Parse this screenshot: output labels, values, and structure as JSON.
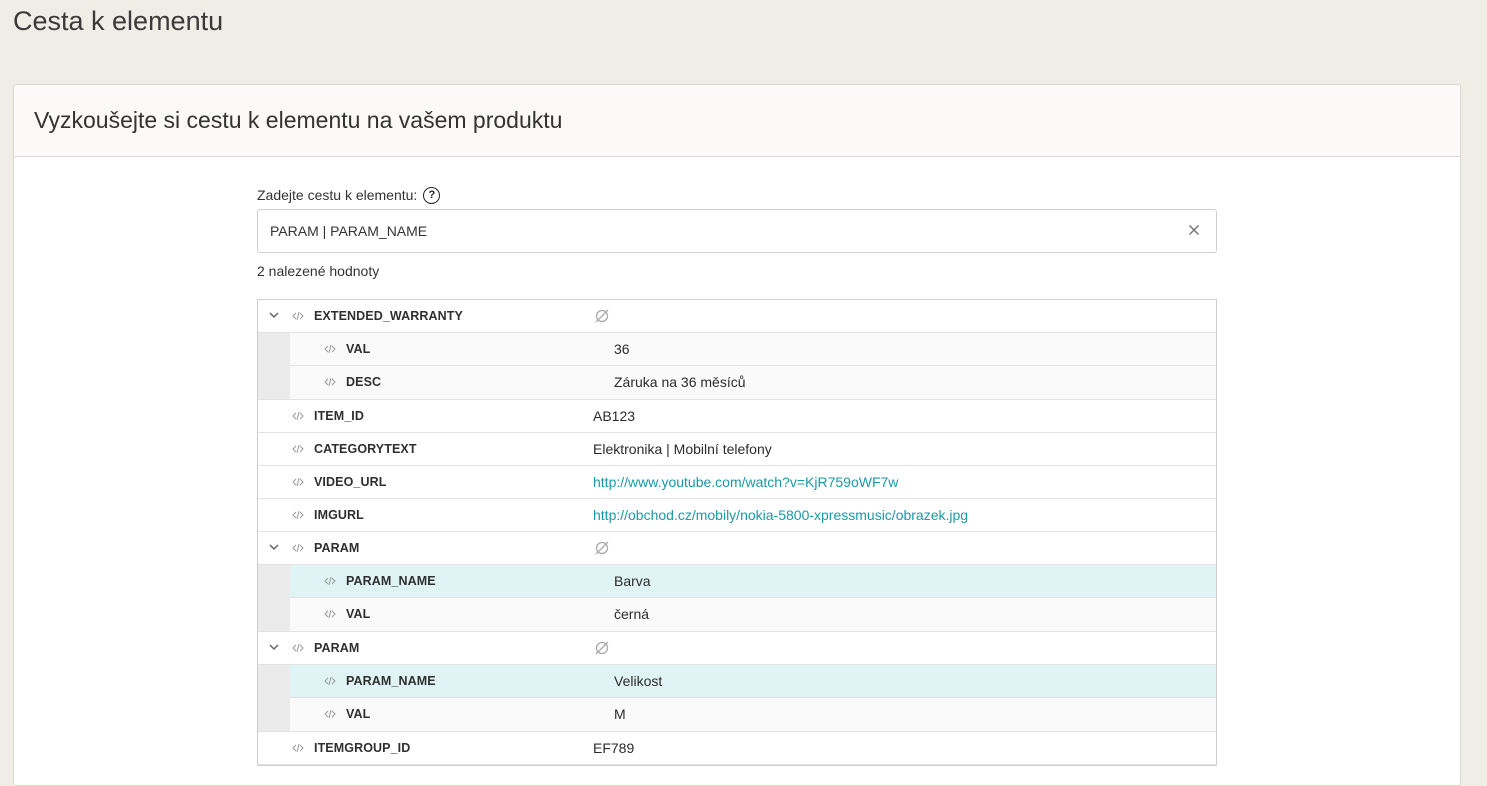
{
  "page": {
    "title": "Cesta k elementu"
  },
  "card": {
    "title": "Vyzkoušejte si cestu k elementu na vašem produktu"
  },
  "form": {
    "label": "Zadejte cestu k elementu:",
    "path_value": "PARAM | PARAM_NAME",
    "found_count": "2 nalezené hodnoty"
  },
  "tree": {
    "g1": {
      "key": "EXTENDED_WARRANTY",
      "c1": {
        "key": "VAL",
        "value": "36"
      },
      "c2": {
        "key": "DESC",
        "value": "Záruka na 36 měsíců"
      }
    },
    "r1": {
      "key": "ITEM_ID",
      "value": "AB123"
    },
    "r2": {
      "key": "CATEGORYTEXT",
      "value": "Elektronika | Mobilní telefony"
    },
    "r3": {
      "key": "VIDEO_URL",
      "value": "http://www.youtube.com/watch?v=KjR759oWF7w"
    },
    "r4": {
      "key": "IMGURL",
      "value": "http://obchod.cz/mobily/nokia-5800-xpressmusic/obrazek.jpg"
    },
    "g2": {
      "key": "PARAM",
      "c1": {
        "key": "PARAM_NAME",
        "value": "Barva"
      },
      "c2": {
        "key": "VAL",
        "value": "černá"
      }
    },
    "g3": {
      "key": "PARAM",
      "c1": {
        "key": "PARAM_NAME",
        "value": "Velikost"
      },
      "c2": {
        "key": "VAL",
        "value": "M"
      }
    },
    "r5": {
      "key": "ITEMGROUP_ID",
      "value": "EF789"
    }
  },
  "colors": {
    "highlight": "#e0f4f6",
    "link": "#1a9aa6",
    "background": "#f0ede7"
  },
  "icons": {
    "help": "question-circle-icon",
    "clear": "close-icon",
    "expand": "chevron-down-icon",
    "element": "code-icon",
    "empty": "empty-set-icon"
  }
}
